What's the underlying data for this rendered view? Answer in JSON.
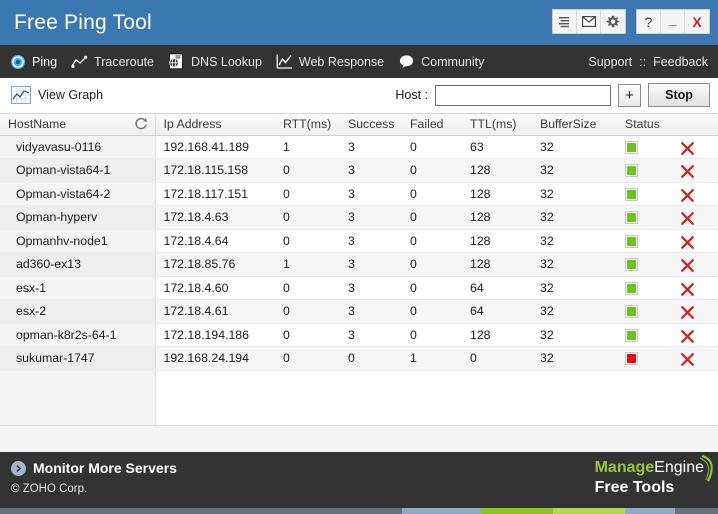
{
  "window": {
    "title": "Free Ping Tool",
    "titlebar_buttons": [
      {
        "name": "menu-icon",
        "tooltip": "Menu"
      },
      {
        "name": "mail-icon",
        "tooltip": "Mail"
      },
      {
        "name": "gear-icon",
        "tooltip": "Settings"
      }
    ],
    "system_buttons": [
      {
        "name": "help-button",
        "label": "?"
      },
      {
        "name": "minimize-button",
        "label": "_"
      },
      {
        "name": "close-button",
        "label": "X"
      }
    ],
    "accent_color": "#3b77b0",
    "nav_bg_color": "#333333"
  },
  "nav": {
    "items": [
      {
        "label": "Ping",
        "icon": "target-icon",
        "active": true
      },
      {
        "label": "Traceroute",
        "icon": "route-line-icon",
        "active": false
      },
      {
        "label": "DNS Lookup",
        "icon": "globe-document-icon",
        "active": false
      },
      {
        "label": "Web Response",
        "icon": "line-chart-icon",
        "active": false
      },
      {
        "label": "Community",
        "icon": "speech-bubble-icon",
        "active": false
      }
    ],
    "support_label": "Support",
    "separator": "::",
    "feedback_label": "Feedback"
  },
  "toolbar": {
    "view_graph_label": "View Graph",
    "host_label": "Host :",
    "host_value": "",
    "host_placeholder": "",
    "add_label": "+",
    "stop_label": "Stop"
  },
  "table": {
    "columns": [
      "HostName",
      "Ip Address",
      "RTT(ms)",
      "Success",
      "Failed",
      "TTL(ms)",
      "BufferSize",
      "Status",
      ""
    ],
    "refresh_icon": "refresh-icon",
    "rows": [
      {
        "host": "vidyavasu-0116",
        "ip": "192.168.41.189",
        "rtt": "1",
        "success": "3",
        "failed": "0",
        "ttl": "63",
        "buffer": "32",
        "status": "up"
      },
      {
        "host": "Opman-vista64-1",
        "ip": "172.18.115.158",
        "rtt": "0",
        "success": "3",
        "failed": "0",
        "ttl": "128",
        "buffer": "32",
        "status": "up"
      },
      {
        "host": "Opman-vista64-2",
        "ip": "172.18.117.151",
        "rtt": "0",
        "success": "3",
        "failed": "0",
        "ttl": "128",
        "buffer": "32",
        "status": "up"
      },
      {
        "host": "Opman-hyperv",
        "ip": "172.18.4.63",
        "rtt": "0",
        "success": "3",
        "failed": "0",
        "ttl": "128",
        "buffer": "32",
        "status": "up"
      },
      {
        "host": "Opmanhv-node1",
        "ip": "172.18.4.64",
        "rtt": "0",
        "success": "3",
        "failed": "0",
        "ttl": "128",
        "buffer": "32",
        "status": "up"
      },
      {
        "host": "ad360-ex13",
        "ip": "172.18.85.76",
        "rtt": "1",
        "success": "3",
        "failed": "0",
        "ttl": "128",
        "buffer": "32",
        "status": "up"
      },
      {
        "host": "esx-1",
        "ip": "172.18.4.60",
        "rtt": "0",
        "success": "3",
        "failed": "0",
        "ttl": "64",
        "buffer": "32",
        "status": "up"
      },
      {
        "host": "esx-2",
        "ip": "172.18.4.61",
        "rtt": "0",
        "success": "3",
        "failed": "0",
        "ttl": "64",
        "buffer": "32",
        "status": "up"
      },
      {
        "host": "opman-k8r2s-64-1",
        "ip": "172.18.194.186",
        "rtt": "0",
        "success": "3",
        "failed": "0",
        "ttl": "128",
        "buffer": "32",
        "status": "up"
      },
      {
        "host": "sukumar-1747",
        "ip": "192.168.24.194",
        "rtt": "0",
        "success": "0",
        "failed": "1",
        "ttl": "0",
        "buffer": "32",
        "status": "down"
      }
    ],
    "status_up_color": "#6bc41b",
    "status_down_color": "#f20b0b",
    "delete_icon": "delete-x-icon"
  },
  "footer": {
    "monitor_label": "Monitor More Servers",
    "copyright": "© ZOHO Corp.",
    "brand_first": "Manage",
    "brand_second": "Engine",
    "brand_tagline": "Free Tools",
    "brand_color": "#94c83d"
  }
}
